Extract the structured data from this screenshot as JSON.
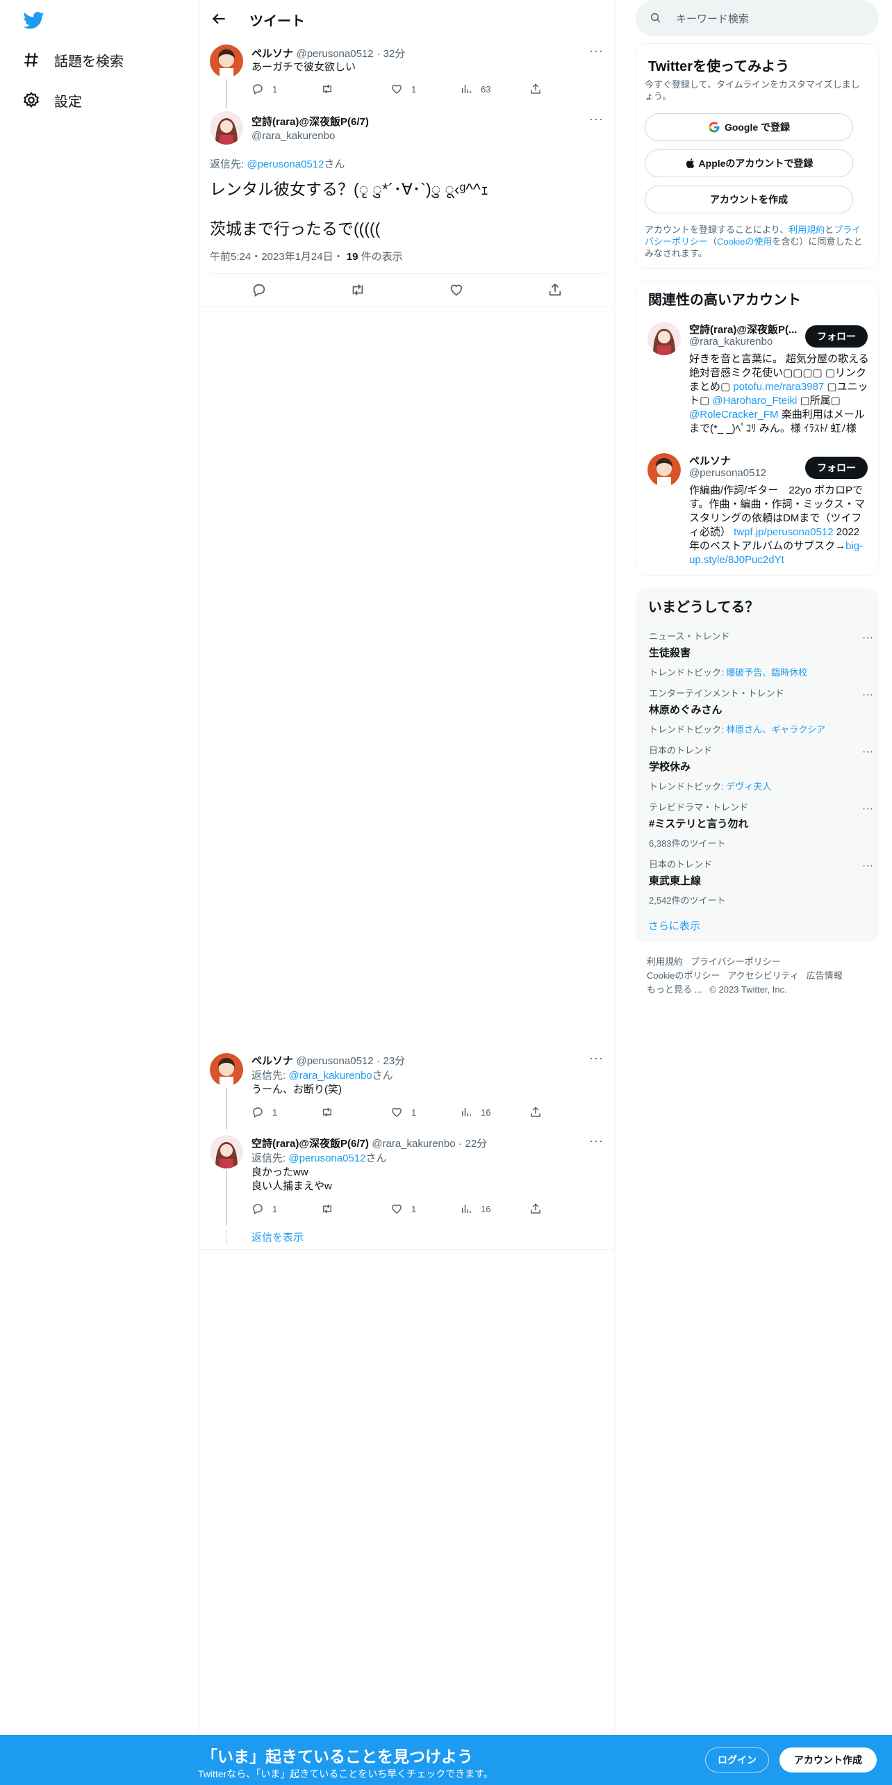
{
  "nav": {
    "explore_label": "話題を検索",
    "settings_label": "設定"
  },
  "header": {
    "title": "ツイート"
  },
  "tweets": {
    "t1": {
      "name": "ペルソナ",
      "handle": "@perusona0512",
      "time": "32分",
      "text": "あーガチで彼女欲しい",
      "replies": "1",
      "likes": "1",
      "views": "63"
    },
    "main": {
      "name": "空詩(rara)@深夜飯P(6/7)",
      "handle": "@rara_kakurenbo",
      "reply_prefix": "返信先:",
      "reply_to": "@perusona0512",
      "reply_suffix": "さん",
      "line1": "レンタル彼女する？(ृ ु*´･∀･`)ु ू‹ᵍ^^ｪ",
      "line2": "茨城まで行ったるで(((((",
      "timestamp": "午前5:24・2023年1月24日・",
      "views_count": "19",
      "views_label": "件の表示"
    },
    "t3": {
      "name": "ペルソナ",
      "handle": "@perusona0512",
      "time": "23分",
      "reply_prefix": "返信先:",
      "reply_to": "@rara_kakurenbo",
      "reply_suffix": "さん",
      "text": "うーん、お断り(笑)",
      "replies": "1",
      "likes": "1",
      "views": "16"
    },
    "t4": {
      "name": "空詩(rara)@深夜飯P(6/7)",
      "handle": "@rara_kakurenbo",
      "time": "22分",
      "reply_prefix": "返信先:",
      "reply_to": "@perusona0512",
      "reply_suffix": "さん",
      "text1": "良かったww",
      "text2": "良い人捕まえやw",
      "replies": "1",
      "likes": "1",
      "views": "16"
    },
    "show_replies": "返信を表示"
  },
  "search": {
    "placeholder": "キーワード検索"
  },
  "signup_box": {
    "title": "Twitterを使ってみよう",
    "desc": "今すぐ登録して、タイムラインをカスタマイズしましょう。",
    "google_label": "Google で登録",
    "apple_label": "Appleのアカウントで登録",
    "create_label": "アカウントを作成",
    "terms_1": "アカウントを登録することにより、",
    "terms_link1": "利用規約",
    "terms_2": "と",
    "terms_link2": "プライバシーポリシー",
    "terms_3": "（",
    "terms_link3": "Cookieの使用",
    "terms_4": "を含む）に同意したとみなされます。"
  },
  "related": {
    "title": "関連性の高いアカウント",
    "a1": {
      "name": "空詩(rara)@深夜飯P(...",
      "handle": "@rara_kakurenbo",
      "follow": "フォロー",
      "bio1": "好きを音と言葉に。 超気分屋の歌える絶対音感ミク花使い▢▢▢▢ ▢リンクまとめ▢ ",
      "bio_link1": "potofu.me/rara3987",
      "bio2": " ▢ユニット▢ ",
      "bio_link2": "@Haroharo_Fteiki",
      "bio3": " ▢所属▢ ",
      "bio_link3": "@RoleCracker_FM",
      "bio4": " 楽曲利用はメールまで(*_ _)ﾍﾟｺﾘ みん。様 ｲﾗｽﾄ/ 虹ﾉ様"
    },
    "a2": {
      "name": "ペルソナ",
      "handle": "@perusona0512",
      "follow": "フォロー",
      "bio1": "作編曲/作詞/ギター　22yo ボカロPです。作曲・編曲・作詞・ミックス・マスタリングの依頼はDMまで（ツイフィ必読） ",
      "bio_link1": "twpf.jp/perusona0512",
      "bio2": " 2022年のベストアルバムのサブスク→",
      "bio_link2": "big-up.style/8J0Puc2dYt"
    }
  },
  "trends": {
    "title": "いまどうしてる？",
    "items": [
      {
        "cat": "ニュース・トレンド",
        "name": "生徒殺害",
        "sub_label": "トレンドトピック: ",
        "sub_link": "爆破予告、臨時休校"
      },
      {
        "cat": "エンターテインメント・トレンド",
        "name": "林原めぐみさん",
        "sub_label": "トレンドトピック: ",
        "sub_link": "林原さん、ギャラクシア"
      },
      {
        "cat": "日本のトレンド",
        "name": "学校休み",
        "sub_label": "トレンドトピック: ",
        "sub_link": "デヴィ夫人"
      },
      {
        "cat": "テレビドラマ・トレンド",
        "name": "#ミステリと言う勿れ",
        "sub_label": "6,383件のツイート",
        "sub_link": ""
      },
      {
        "cat": "日本のトレンド",
        "name": "東武東上線",
        "sub_label": "2,542件のツイート",
        "sub_link": ""
      }
    ],
    "show_more": "さらに表示"
  },
  "footer": {
    "terms": "利用規約",
    "privacy": "プライバシーポリシー",
    "cookie": "Cookieのポリシー",
    "accessibility": "アクセシビリティ",
    "ads": "広告情報",
    "more": "もっと見る ...",
    "copyright": "© 2023 Twitter, Inc."
  },
  "bottom_bar": {
    "headline": "「いま」起きていることを見つけよう",
    "sub": "Twitterなら、「いま」起きていることをいち早くチェックできます。",
    "login": "ログイン",
    "signup": "アカウント作成"
  },
  "colors": {
    "accent": "#1d9bf0",
    "text": "#0f1419",
    "muted": "#536471"
  }
}
